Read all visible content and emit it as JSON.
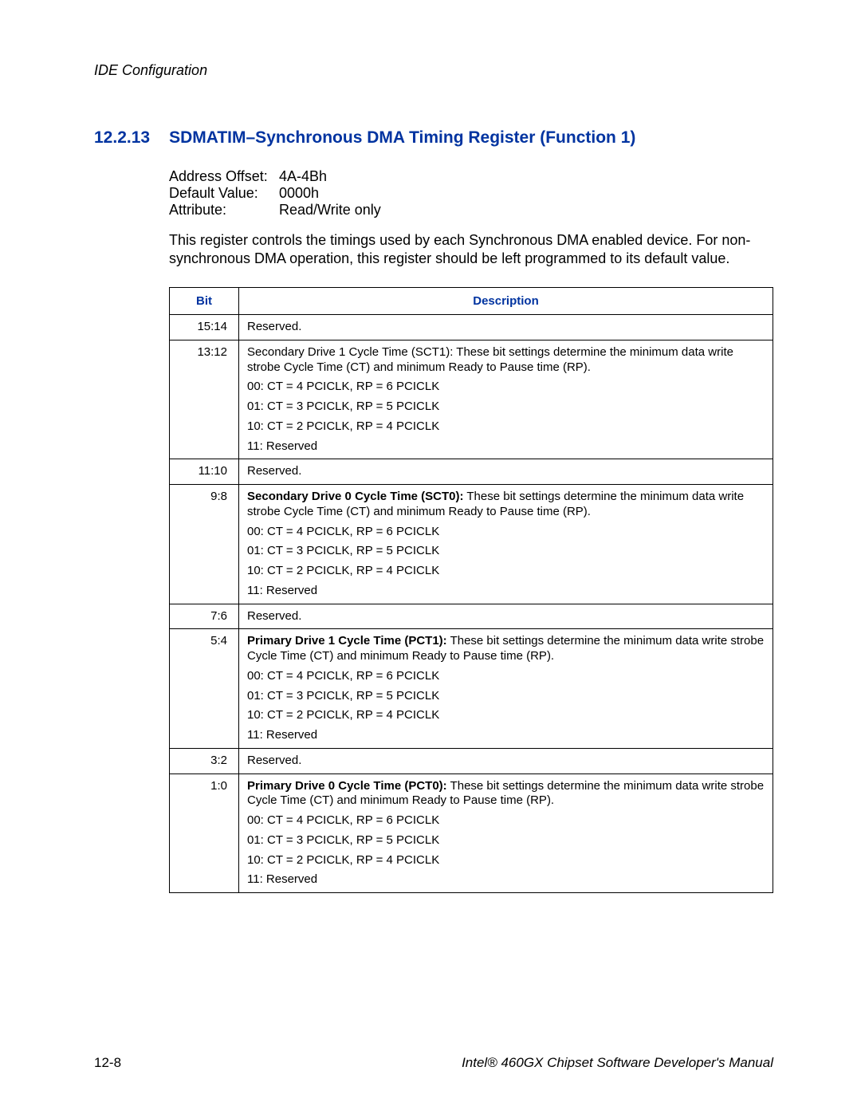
{
  "running_head": "IDE Configuration",
  "section": {
    "number": "12.2.13",
    "title": "SDMATIM–Synchronous DMA Timing Register (Function 1)"
  },
  "meta": {
    "address_offset_label": "Address Offset:",
    "address_offset_value": "4A-4Bh",
    "default_value_label": "Default Value:",
    "default_value_value": "0000h",
    "attribute_label": "Attribute:",
    "attribute_value": "Read/Write only"
  },
  "intro": "This register controls the timings used by each Synchronous DMA enabled device. For non-synchronous DMA operation, this register should be left programmed to its default value.",
  "table": {
    "headers": {
      "bit": "Bit",
      "description": "Description"
    },
    "rows": [
      {
        "bit": "15:14",
        "lines": [
          {
            "text": "Reserved."
          }
        ]
      },
      {
        "bit": "13:12",
        "lines": [
          {
            "text": "Secondary Drive 1 Cycle Time (SCT1): These bit settings determine the minimum data write strobe Cycle Time (CT) and minimum Ready to Pause time (RP)."
          },
          {
            "text": "00: CT = 4 PCICLK, RP = 6 PCICLK"
          },
          {
            "text": "01: CT = 3 PCICLK, RP = 5 PCICLK"
          },
          {
            "text": "10: CT = 2 PCICLK, RP = 4 PCICLK"
          },
          {
            "text": "11: Reserved"
          }
        ]
      },
      {
        "bit": "11:10",
        "lines": [
          {
            "text": "Reserved."
          }
        ]
      },
      {
        "bit": "9:8",
        "lines": [
          {
            "bold": "Secondary Drive 0 Cycle Time (SCT0):",
            "rest": " These bit settings determine the minimum data write strobe Cycle Time (CT) and minimum Ready to Pause time (RP)."
          },
          {
            "text": "00: CT = 4 PCICLK, RP = 6 PCICLK"
          },
          {
            "text": "01: CT = 3 PCICLK, RP = 5 PCICLK"
          },
          {
            "text": "10: CT = 2 PCICLK, RP = 4 PCICLK"
          },
          {
            "text": "11: Reserved"
          }
        ]
      },
      {
        "bit": "7:6",
        "lines": [
          {
            "text": "Reserved."
          }
        ]
      },
      {
        "bit": "5:4",
        "lines": [
          {
            "bold": "Primary Drive 1 Cycle Time (PCT1):",
            "rest": " These bit settings determine the minimum data write strobe Cycle Time (CT) and minimum Ready to Pause time (RP)."
          },
          {
            "text": "00: CT = 4 PCICLK, RP = 6 PCICLK"
          },
          {
            "text": "01: CT = 3 PCICLK, RP = 5 PCICLK"
          },
          {
            "text": "10: CT = 2 PCICLK, RP = 4 PCICLK"
          },
          {
            "text": "11: Reserved"
          }
        ]
      },
      {
        "bit": "3:2",
        "lines": [
          {
            "text": "Reserved."
          }
        ]
      },
      {
        "bit": "1:0",
        "lines": [
          {
            "bold": "Primary Drive 0 Cycle Time (PCT0):",
            "rest": " These bit settings determine the minimum data write strobe Cycle Time (CT) and minimum Ready to Pause time (RP)."
          },
          {
            "text": "00: CT = 4 PCICLK, RP = 6 PCICLK"
          },
          {
            "text": "01: CT = 3 PCICLK, RP = 5 PCICLK"
          },
          {
            "text": "10: CT = 2 PCICLK, RP = 4 PCICLK"
          },
          {
            "text": "11: Reserved"
          }
        ]
      }
    ]
  },
  "footer": {
    "left": "12-8",
    "right": "Intel® 460GX Chipset Software Developer's Manual"
  }
}
